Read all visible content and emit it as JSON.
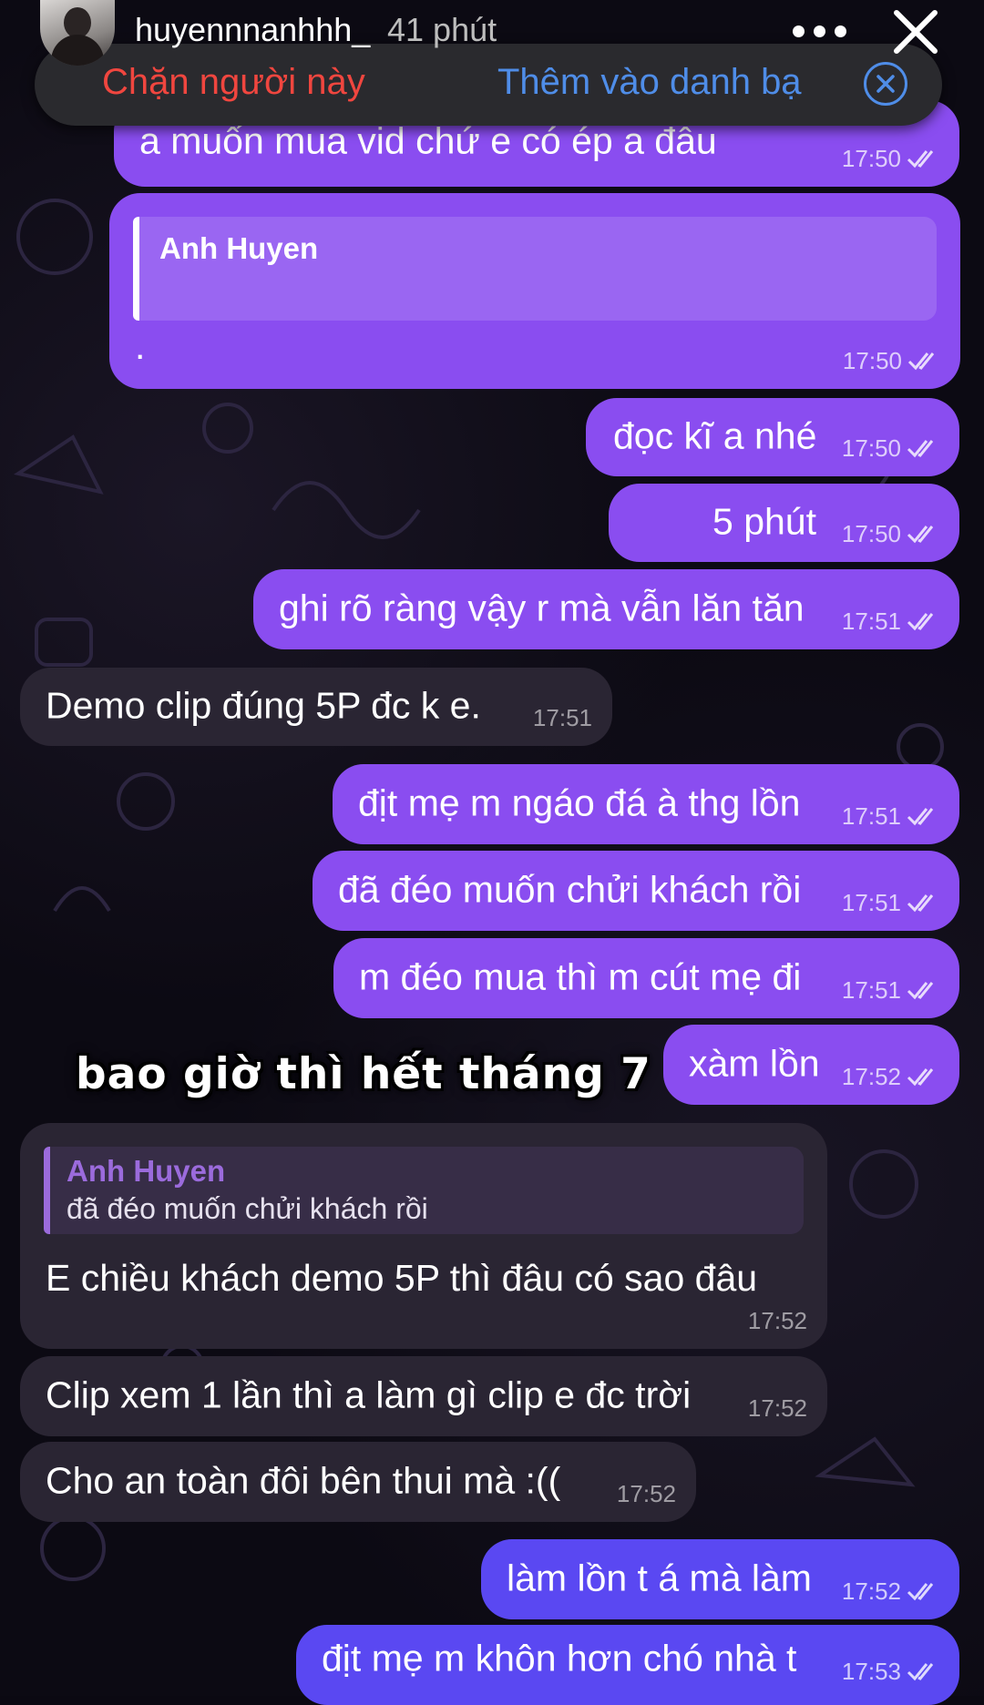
{
  "story": {
    "username": "huyennnanhhh_",
    "time_ago": "41 phút"
  },
  "contact_bar": {
    "block_label": "Chặn người này",
    "add_contact_label": "Thêm vào danh bạ"
  },
  "sticker_text": "bao giờ thì hết tháng 7",
  "messages": [
    {
      "text": "a muốn mua vid       chứ e có ép a đâu",
      "time": "17:50"
    },
    {
      "reply_to": "Anh Huyen",
      "reply_text": "",
      "text": ".",
      "time": "17:50"
    },
    {
      "text": "đọc kĩ a nhé",
      "time": "17:50"
    },
    {
      "text": "5 phút",
      "time": "17:50"
    },
    {
      "text": "ghi rõ ràng vậy r mà vẫn lăn tăn",
      "time": "17:51"
    },
    {
      "text": "Demo clip đúng 5P đc k e.",
      "time": "17:51"
    },
    {
      "text": "địt mẹ m ngáo đá à thg lồn",
      "time": "17:51"
    },
    {
      "text": "đã đéo muốn chửi khách rồi",
      "time": "17:51"
    },
    {
      "text": "m đéo mua thì m cút mẹ đi",
      "time": "17:51"
    },
    {
      "text": "xàm lồn",
      "time": "17:52"
    },
    {
      "reply_to": "Anh Huyen",
      "reply_text": "đã đéo muốn chửi khách rồi",
      "text": "E chiều khách demo 5P thì đâu có sao đâu",
      "time": "17:52"
    },
    {
      "text": "Clip xem 1 lần thì a làm gì clip e đc trời",
      "time": "17:52"
    },
    {
      "text": "Cho an toàn đôi bên thui mà :((",
      "time": "17:52"
    },
    {
      "text": "làm lồn t á mà làm",
      "time": "17:52"
    },
    {
      "text": "địt mẹ m khôn hơn chó nhà t",
      "time": "17:53"
    }
  ],
  "icons": {
    "read_receipt": "double-check-icon",
    "more": "more-dots-icon",
    "close": "close-icon",
    "dismiss": "circle-x-icon"
  },
  "colors": {
    "outgoing": "#8a4df0",
    "outgoing_latest": "#5a48f2",
    "incoming": "#2a2533",
    "block_red": "#f0463f",
    "link_blue": "#4f8de8"
  }
}
